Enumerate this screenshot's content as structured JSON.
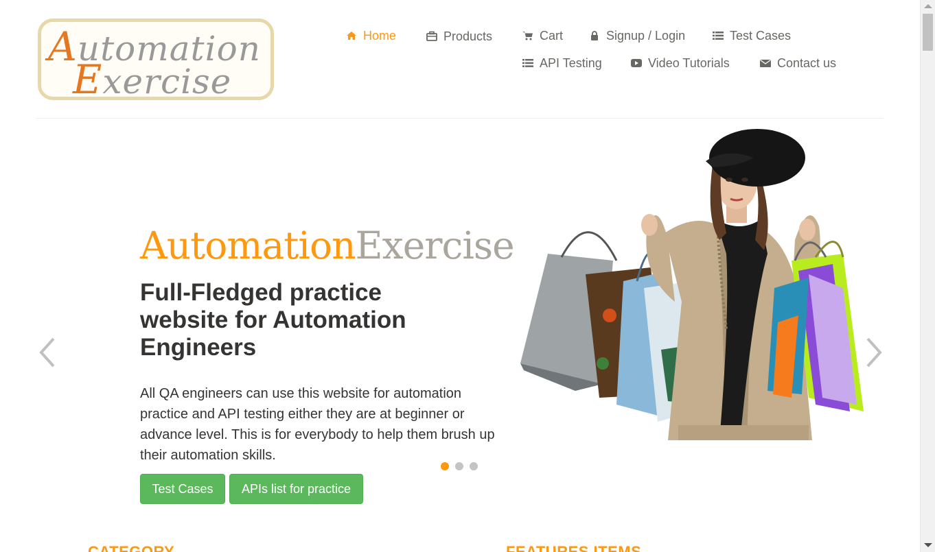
{
  "logo": {
    "line1_cap": "A",
    "line1_rest": "utomation",
    "line2_cap": "E",
    "line2_rest": "xercise"
  },
  "nav": {
    "home": "Home",
    "products": "Products",
    "cart": "Cart",
    "signup_login": "Signup / Login",
    "test_cases": "Test Cases",
    "api_testing": "API Testing",
    "video_tutorials": "Video Tutorials",
    "contact_us": "Contact us"
  },
  "slider": {
    "brand_part1": "Automation",
    "brand_part2": "Exercise",
    "headline": "Full-Fledged practice website for Automation Engineers",
    "description": "All QA engineers can use this website for automation practice and API testing either they are at beginner or advance level. This is for everybody to help them brush up their automation skills.",
    "button_test_cases": "Test Cases",
    "button_apis": "APIs list for practice",
    "active_slide": 1,
    "slide_count": 3
  },
  "sections": {
    "category_title": "CATEGORY",
    "features_title": "FEATURES ITEMS"
  },
  "colors": {
    "accent": "#FE980F",
    "button_green": "#5cb85c",
    "text_dark": "#363432",
    "nav_text": "#696763"
  },
  "icons": {
    "home": "home-icon",
    "products": "briefcase-icon",
    "cart": "cart-icon",
    "signup_login": "lock-icon",
    "test_cases": "list-icon",
    "api_testing": "list-icon",
    "video_tutorials": "youtube-play-icon",
    "contact_us": "envelope-icon"
  }
}
